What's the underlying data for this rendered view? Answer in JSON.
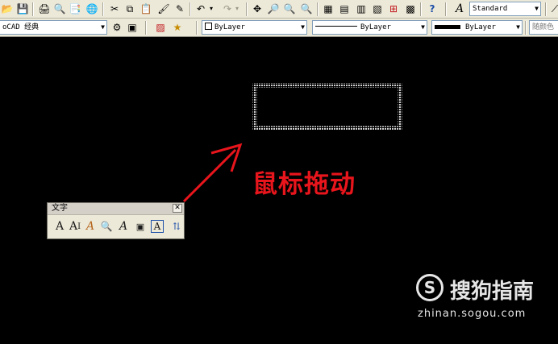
{
  "toolbar_top": {
    "text_style": "Standard"
  },
  "toolbar_second": {
    "workspace": "oCAD 经典",
    "color": "ByLayer",
    "linetype": "ByLayer",
    "lineweight": "ByLayer",
    "plotstyle": "随颜色"
  },
  "text_panel": {
    "title": "文字",
    "close": "✕"
  },
  "annotation": "鼠标拖动",
  "watermark": {
    "logo": "S",
    "brand": "搜狗指南",
    "url": "zhinan.sogou.com"
  },
  "colors": {
    "annotation": "#e8151c",
    "selection": "#c8c8c8"
  }
}
